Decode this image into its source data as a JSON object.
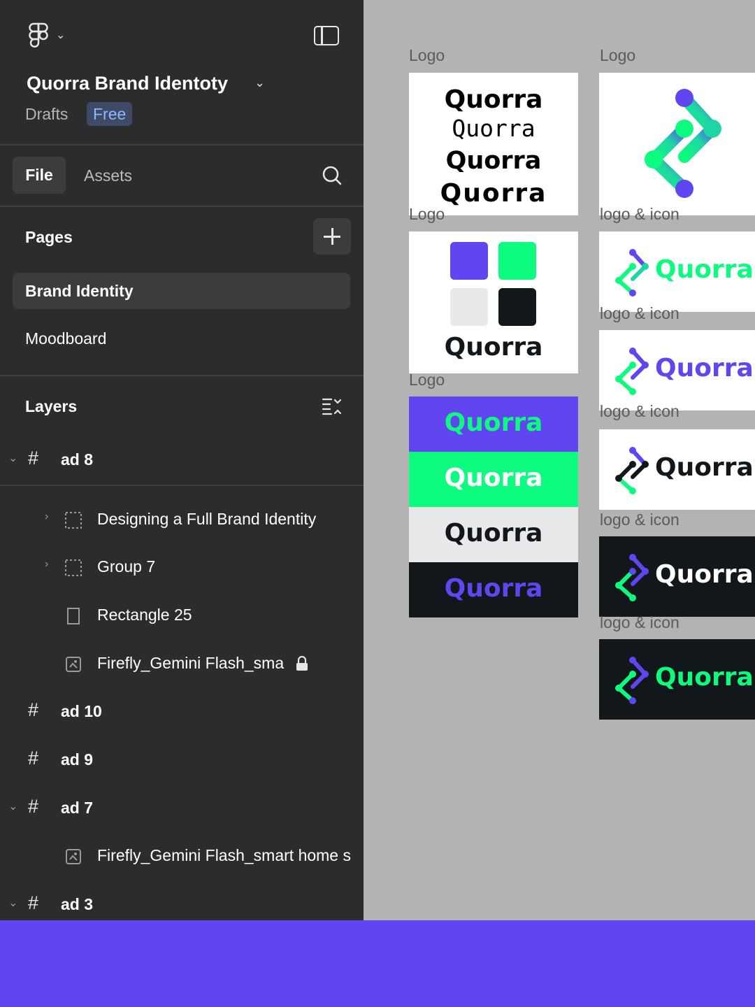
{
  "app": {
    "file_title": "Quorra Brand Identoty",
    "location": "Drafts",
    "plan_badge": "Free"
  },
  "tabs": {
    "file": "File",
    "assets": "Assets"
  },
  "pages": {
    "title": "Pages",
    "items": [
      "Brand Identity",
      "Moodboard"
    ],
    "active_index": 0
  },
  "layers": {
    "title": "Layers",
    "items": [
      {
        "name": "ad 8",
        "type": "frame",
        "expanded": true
      },
      {
        "name": "Designing a Full Brand Identity",
        "type": "group",
        "collapsed": true
      },
      {
        "name": "Group 7",
        "type": "group",
        "collapsed": true
      },
      {
        "name": "Rectangle 25",
        "type": "rectangle"
      },
      {
        "name": "Firefly_Gemini Flash_sma",
        "type": "image",
        "locked": true
      },
      {
        "name": "ad 10",
        "type": "frame"
      },
      {
        "name": "ad 9",
        "type": "frame"
      },
      {
        "name": "ad 7",
        "type": "frame",
        "expanded": true
      },
      {
        "name": "Firefly_Gemini Flash_smart home s",
        "type": "image"
      },
      {
        "name": "ad 3",
        "type": "frame",
        "expanded": true
      }
    ]
  },
  "canvas": {
    "wordmark": "Quorra",
    "frame_labels": [
      "Logo",
      "Logo",
      "Logo",
      "Logo",
      "logo & icon",
      "logo & icon",
      "logo & icon",
      "logo & icon",
      "logo & icon"
    ],
    "colors": {
      "purple": "#5f46f0",
      "green": "#0dfb7e",
      "light_gray": "#e9e9ec",
      "dark": "#12171b",
      "white": "#ffffff"
    }
  }
}
